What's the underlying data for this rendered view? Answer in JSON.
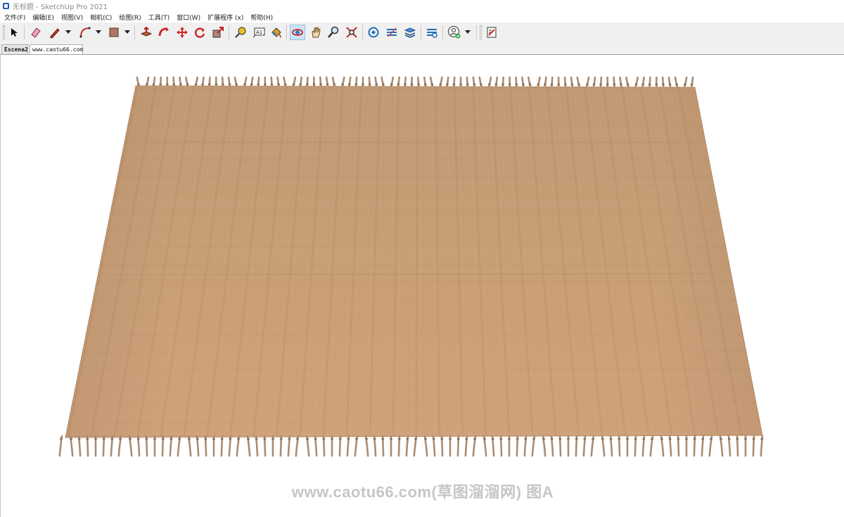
{
  "window": {
    "title": "无标题 - SketchUp Pro 2021"
  },
  "menu": [
    "文件(F)",
    "编辑(E)",
    "视图(V)",
    "相机(C)",
    "绘图(R)",
    "工具(T)",
    "窗口(W)",
    "扩展程序 (x)",
    "帮助(H)"
  ],
  "toolbar": {
    "tools": [
      {
        "icon": "select-arrow-icon"
      },
      {
        "icon": "eraser-icon"
      },
      {
        "icon": "pencil-line-icon"
      },
      {
        "icon": "arc-icon"
      },
      {
        "icon": "rectangle-icon"
      },
      {
        "icon": "push-pull-icon"
      },
      {
        "icon": "follow-me-icon"
      },
      {
        "icon": "move-icon"
      },
      {
        "icon": "rotate-icon"
      },
      {
        "icon": "scale-icon"
      },
      {
        "icon": "tape-measure-icon"
      },
      {
        "icon": "text-icon"
      },
      {
        "icon": "paint-bucket-icon"
      },
      {
        "icon": "orbit-icon"
      },
      {
        "icon": "pan-icon"
      },
      {
        "icon": "zoom-icon"
      },
      {
        "icon": "zoom-extents-icon"
      },
      {
        "icon": "3d-warehouse-icon"
      },
      {
        "icon": "extension-warehouse-icon"
      },
      {
        "icon": "layout-icon"
      },
      {
        "icon": "extension-manager-icon"
      },
      {
        "icon": "profile-icon"
      },
      {
        "icon": "send-to-layout-icon"
      }
    ],
    "text_icon_label": "A1"
  },
  "scene_tabs": [
    "Escena2",
    "www.caotu66.com"
  ],
  "viewport": {
    "object": "fringed jute rug",
    "colors": {
      "rug": "#c99a72",
      "fringe": "#a98c73"
    }
  },
  "watermark": "www.caotu66.com(草图溜溜网) 图A"
}
